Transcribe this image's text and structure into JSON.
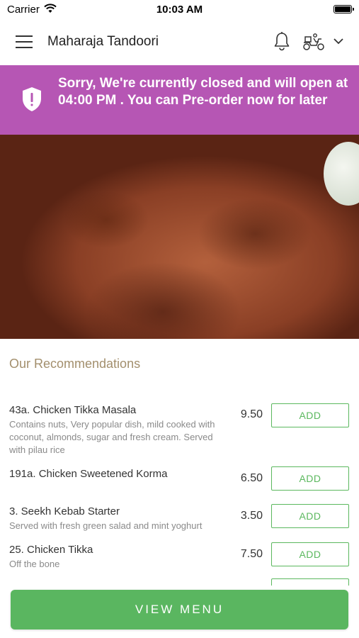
{
  "status_bar": {
    "carrier": "Carrier",
    "time": "10:03 AM"
  },
  "header": {
    "title": "Maharaja Tandoori"
  },
  "banner": {
    "message": "Sorry, We're currently closed and will open at 04:00 PM . You can Pre-order now for later",
    "color": "#b656b4"
  },
  "recommendations": {
    "title": "Our Recommendations",
    "items": [
      {
        "name": "43a. Chicken Tikka Masala",
        "description": "Contains nuts, Very popular dish, mild cooked with coconut, almonds, sugar and fresh cream. Served with pilau rice",
        "price": "9.50",
        "button": "ADD"
      },
      {
        "name": "191a. Chicken Sweetened Korma",
        "description": "",
        "price": "6.50",
        "button": "ADD"
      },
      {
        "name": "3. Seekh Kebab Starter",
        "description": "Served with fresh green salad and mint yoghurt",
        "price": "3.50",
        "button": "ADD"
      },
      {
        "name": "25. Chicken Tikka",
        "description": "Off the bone",
        "price": "7.50",
        "button": "ADD"
      }
    ]
  },
  "footer": {
    "view_menu_label": "VIEW MENU",
    "accent": "#5ab660"
  },
  "icons": [
    "menu-icon",
    "bell-icon",
    "delivery-scooter-icon",
    "chevron-down-icon",
    "shield-alert-icon",
    "wifi-icon",
    "battery-icon"
  ]
}
